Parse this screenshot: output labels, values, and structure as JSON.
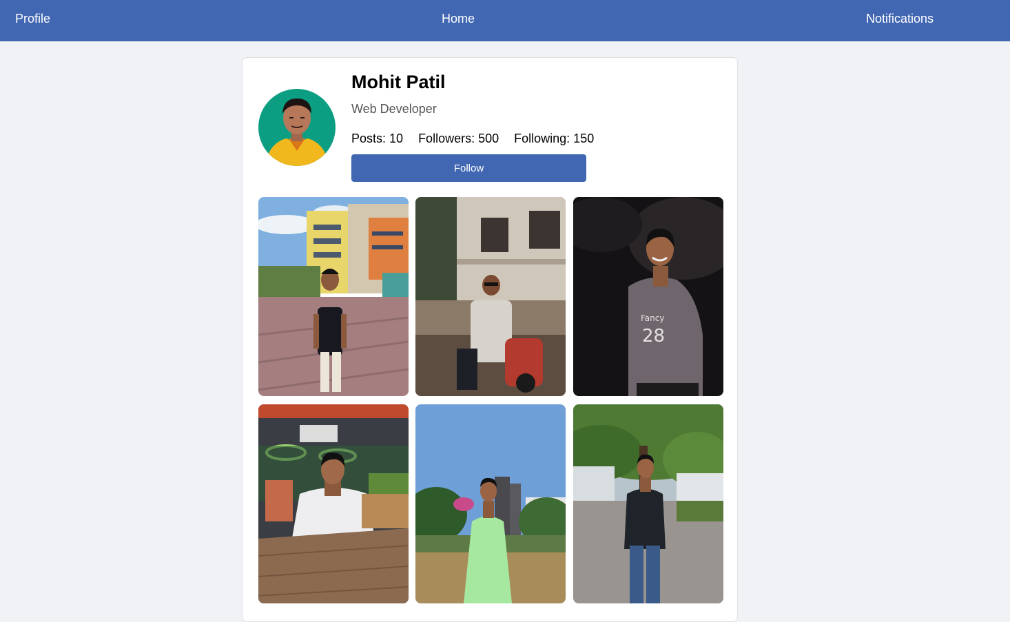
{
  "navbar": {
    "profile_label": "Profile",
    "home_label": "Home",
    "notifications_label": "Notifications",
    "background": "#4267b2"
  },
  "profile": {
    "name": "Mohit Patil",
    "bio": "Web Developer",
    "stats": {
      "posts": "Posts: 10",
      "followers": "Followers: 500",
      "following": "Following: 150"
    },
    "follow_button": "Follow",
    "avatar_icon": "profile-photo"
  },
  "gallery": {
    "photos": [
      {
        "icon": "photo-campus-building"
      },
      {
        "icon": "photo-scooter-street"
      },
      {
        "icon": "photo-night-tshirt"
      },
      {
        "icon": "photo-cafe-table"
      },
      {
        "icon": "photo-kurta-park"
      },
      {
        "icon": "photo-tree-pathway"
      }
    ]
  },
  "colors": {
    "accent": "#4267b2",
    "page_background": "#f0f2f5"
  }
}
